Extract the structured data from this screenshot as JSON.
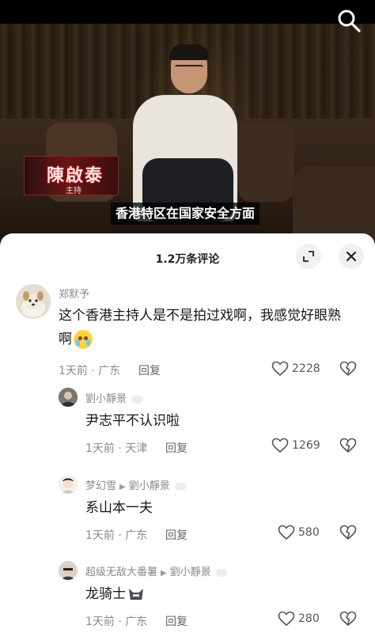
{
  "video": {
    "name_tag": "陳啟泰",
    "name_tag_role": "主持",
    "subtitle": "香港特区在国家安全方面"
  },
  "sheet": {
    "title": "1.2万条评论"
  },
  "comments": [
    {
      "user": "郑默予",
      "text": "这个香港主持人是不是拍过戏啊，我感觉好眼熟",
      "text_line2": "啊",
      "emoji": "crying-laughing-emoji",
      "time_loc": "1天前 · 广东",
      "reply_label": "回复",
      "likes": "2228"
    },
    {
      "user": "劉小靜景",
      "text": "尹志平不认识啦",
      "time_loc": "1天前 · 天津",
      "reply_label": "回复",
      "likes": "1269"
    },
    {
      "user": "梦幻雪",
      "reply_to": "劉小靜景",
      "text": "系山本一夫",
      "time_loc": "1天前 · 广东",
      "reply_label": "回复",
      "likes": "580"
    },
    {
      "user": "超级无敌大番薯",
      "reply_to": "劉小靜景",
      "text": "龙骑士",
      "emoji": "knight-helmet-emoji",
      "time_loc": "1天前 · 广东",
      "reply_label": "回复",
      "likes": "280"
    }
  ],
  "icons": {
    "search": "search-icon",
    "expand": "expand-icon",
    "close": "close-icon",
    "like": "heart-icon",
    "dislike": "broken-heart-icon"
  },
  "colors": {
    "sheet_bg": "#ffffff",
    "meta_text": "#8a8a8a",
    "name_tag_red": "#6a1616"
  }
}
